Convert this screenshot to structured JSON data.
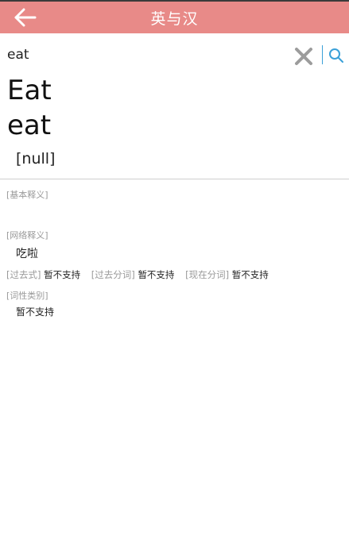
{
  "header": {
    "title": "英与汉",
    "back_icon": "arrow-left-icon"
  },
  "search": {
    "value": "eat",
    "clear_icon": "close-icon",
    "search_icon": "search-icon"
  },
  "entry": {
    "word_capitalized": "Eat",
    "word": "eat",
    "phonetic": "[null]"
  },
  "sections": {
    "basic_label": "[基本释义]",
    "web_label": "[网络释义]",
    "web_value": "吃啦",
    "forms": [
      {
        "label": "[过去式]",
        "value": "暂不支持"
      },
      {
        "label": "[过去分词]",
        "value": "暂不支持"
      },
      {
        "label": "[现在分词]",
        "value": "暂不支持"
      }
    ],
    "pos_label": "[词性类别]",
    "pos_value": "暂不支持"
  },
  "colors": {
    "header_bg": "#e88a88",
    "title": "#ffffff",
    "label": "#9a9a9a",
    "accent": "#3aa0d8"
  }
}
